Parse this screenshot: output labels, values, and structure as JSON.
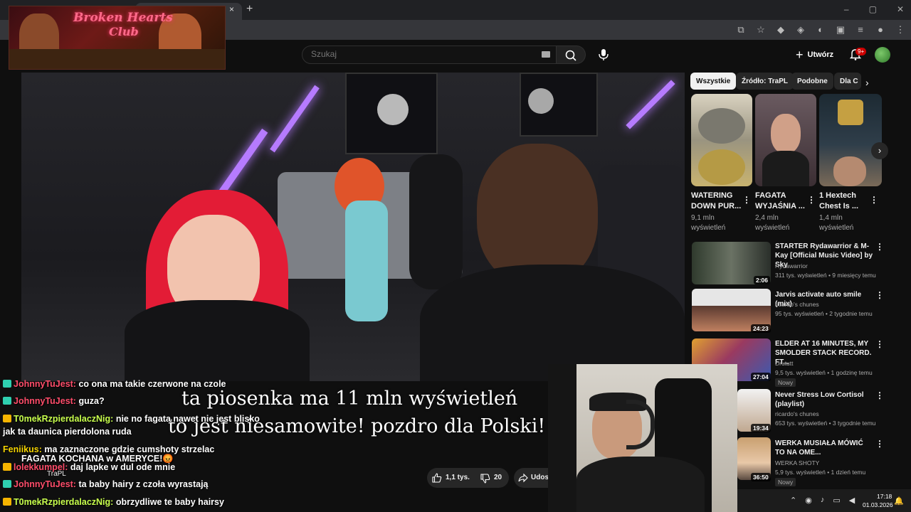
{
  "browser": {
    "tab_close": "×",
    "tab_new": "+",
    "window_controls": [
      "–",
      "▢",
      "✕"
    ]
  },
  "overlay_logo": {
    "title": "Broken Hearts",
    "subtitle": "Club"
  },
  "header": {
    "search_placeholder": "Szukaj",
    "create_label": "Utwórz",
    "notifications_badge": "9+"
  },
  "subtitles": {
    "line1": "ta piosenka ma 11 mln wyświetleń",
    "line2": "to jest niesamowite! pozdro dla Polski!"
  },
  "chat": [
    {
      "user": "JohnnyTuJest:",
      "user_color": "#ff4d6a",
      "badge_color": "#2fd0b0",
      "msg": "co ona ma takie czerwone na czole"
    },
    {
      "user": "JohnnyTuJest:",
      "user_color": "#ff4d6a",
      "badge_color": "#2fd0b0",
      "msg": "guza?"
    },
    {
      "user": "T0mekRzpierdalaczNig:",
      "user_color": "#c8ff4d",
      "badge_color": "#f5b400",
      "msg": "nie no fagata nawet nie jest blisko"
    },
    {
      "user": "",
      "user_color": "#fff",
      "badge_color": "",
      "msg": "jak ta daunica pierdolona ruda"
    },
    {
      "user": "Feniikus:",
      "user_color": "#f5d400",
      "badge_color": "",
      "msg": "ma zaznaczone gdzie cumshoty strzelac"
    },
    {
      "user": "",
      "user_color": "#fff",
      "badge_color": "",
      "msg": "FAGATA KOCHANA w AMERYCE!😡"
    },
    {
      "user": "lolekkumpel:",
      "user_color": "#ff4d6a",
      "badge_color": "#f5b400",
      "msg": "daj lapke w dul ode mnie"
    },
    {
      "user": "JohnnyTuJest:",
      "user_color": "#ff4d6a",
      "badge_color": "#2fd0b0",
      "msg": "ta baby hairy z czoła wyrastają"
    },
    {
      "user": "T0mekRzpierdalaczNig:",
      "user_color": "#c8ff4d",
      "badge_color": "#f5b400",
      "msg": "obrzydliwe te baby hairsy"
    }
  ],
  "video_actions": {
    "channel": "TraPL",
    "likes": "1,1 tys.",
    "dislikes": "20",
    "share": "Udos"
  },
  "sidebar": {
    "chips": [
      "Wszystkie",
      "Źródło: TraPL",
      "Podobne",
      "Dla C"
    ],
    "shorts": [
      {
        "title": "WATERING DOWN PUR...",
        "views": "9,1 mln wyświetleń"
      },
      {
        "title": "FAGATA WYJAŚNIA ...",
        "views": "2,4 mln wyświetleń"
      },
      {
        "title": "1 Hextech Chest Is ...",
        "views": "1,4 mln wyświetleń"
      }
    ],
    "recommendations": [
      {
        "title": "STARTER Rydawarrior & M-Kay [Official Music Video] by Sky",
        "channel": "Rydawarrior",
        "meta": "311 tys. wyświetleń • 9 miesięcy temu",
        "duration": "2:06",
        "new": ""
      },
      {
        "title": "Jarvis activate auto smile (mix)",
        "channel": "ricardo's chunes",
        "meta": "95 tys. wyświetleń • 2 tygodnie temu",
        "duration": "24:23",
        "new": ""
      },
      {
        "title": "ELDER AT 16 MINUTES, MY SMOLDER STACK RECORD. FT...",
        "channel": "Drututt",
        "meta": "9,5 tys. wyświetleń • 1 godzinę temu",
        "duration": "27:04",
        "new": "Nowy"
      },
      {
        "title": "Never Stress Low Cortisol (playlist)",
        "channel": "ricardo's chunes",
        "meta": "653 tys. wyświetleń • 3 tygodnie temu",
        "duration": "19:34",
        "new": ""
      },
      {
        "title": "WERKA MUSIAŁA MÓWIĆ TO NA OME...",
        "channel": "WERKA SHOTY",
        "meta": "5,9 tys. wyświetleń • 1 dzień temu",
        "duration": "36:50",
        "new": "Nowy"
      }
    ]
  },
  "taskbar": {
    "time": "17:18",
    "date": "01.03.2026"
  },
  "colors": {
    "accent_red": "#cc0000",
    "background": "#0f0f0f",
    "chip_bg": "#272727"
  }
}
